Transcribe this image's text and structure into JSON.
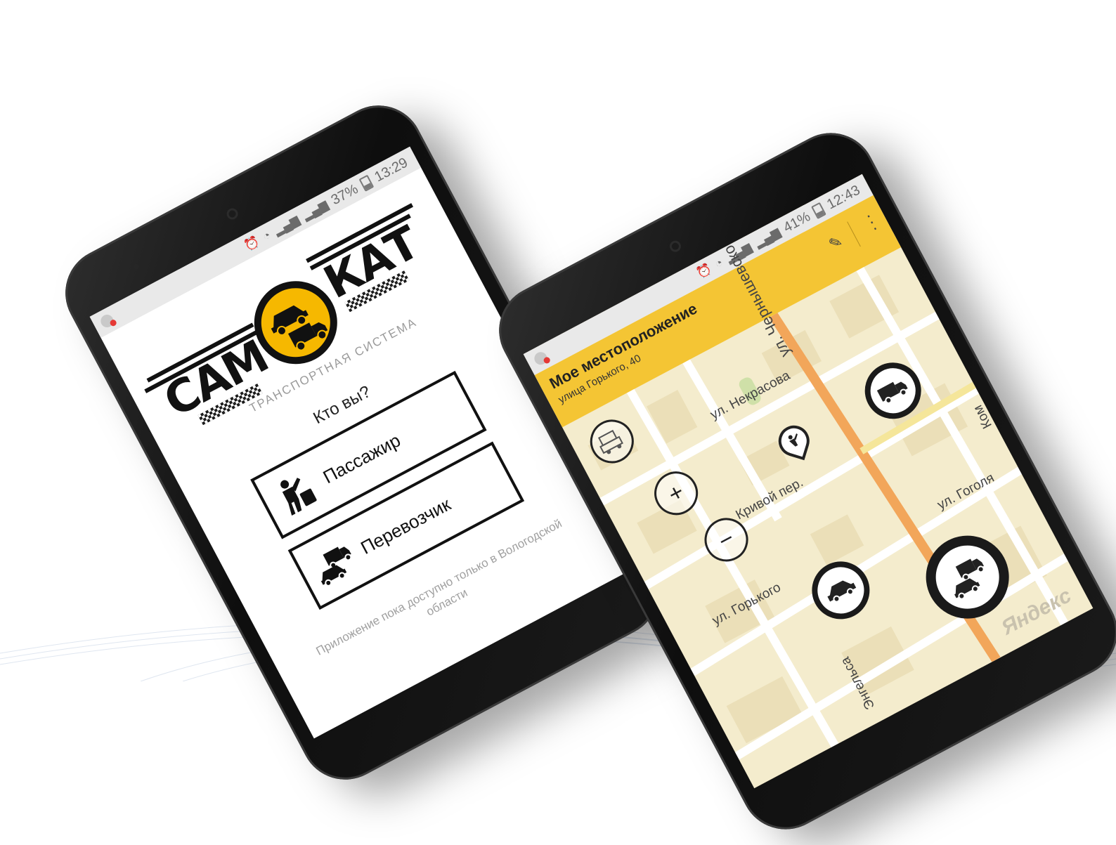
{
  "phone_left": {
    "status": {
      "battery": "37%",
      "time": "13:29"
    },
    "logo": {
      "left_word": "САМ",
      "right_word": "КАТ",
      "subtitle": "ТРАНСПОРТНАЯ СИСТЕМА"
    },
    "question": "Кто вы?",
    "roles": [
      {
        "label": "Пассажир",
        "icon": "hitchhiker-icon"
      },
      {
        "label": "Перевозчик",
        "icon": "truck-icon"
      }
    ],
    "region_note": "Приложение пока доступно только в Вологодской области"
  },
  "phone_right": {
    "status": {
      "battery": "41%",
      "time": "12:43"
    },
    "header": {
      "title": "Мое местоположение",
      "address": "улица Горького, 40"
    },
    "streets": {
      "nekrasova": "ул. Некрасова",
      "chernyshevskogo": "ул. Чернышевского",
      "krivoy": "Кривой пер.",
      "gorkogo": "ул. Горького",
      "gogolya": "ул. Гоголя",
      "engelsa": "Энгельса",
      "kom": "Ком"
    },
    "map_controls": [
      "vehicles-filter-icon",
      "zoom-in-icon",
      "zoom-out-icon"
    ],
    "branding": "Яндекс",
    "colors": {
      "accent": "#f4c534",
      "map_bg": "#f4eccd",
      "main_road": "#f2a65a"
    }
  }
}
